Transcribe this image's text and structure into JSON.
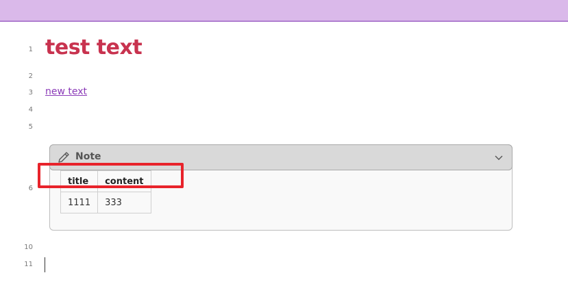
{
  "editor": {
    "line_numbers": [
      "1",
      "2",
      "3",
      "4",
      "5",
      "6",
      "10",
      "11"
    ],
    "heading": "test text",
    "link_text": "new text",
    "callout": {
      "title": "Note",
      "icon": "pencil-icon",
      "collapse_icon": "chevron-down-icon",
      "table": {
        "headers": [
          "title",
          "content"
        ],
        "rows": [
          [
            "1111",
            "333"
          ]
        ]
      }
    }
  },
  "colors": {
    "top_bar": "#dab9ea",
    "heading": "#c8334f",
    "link": "#8b3bb8",
    "highlight_box": "#e8232b"
  }
}
